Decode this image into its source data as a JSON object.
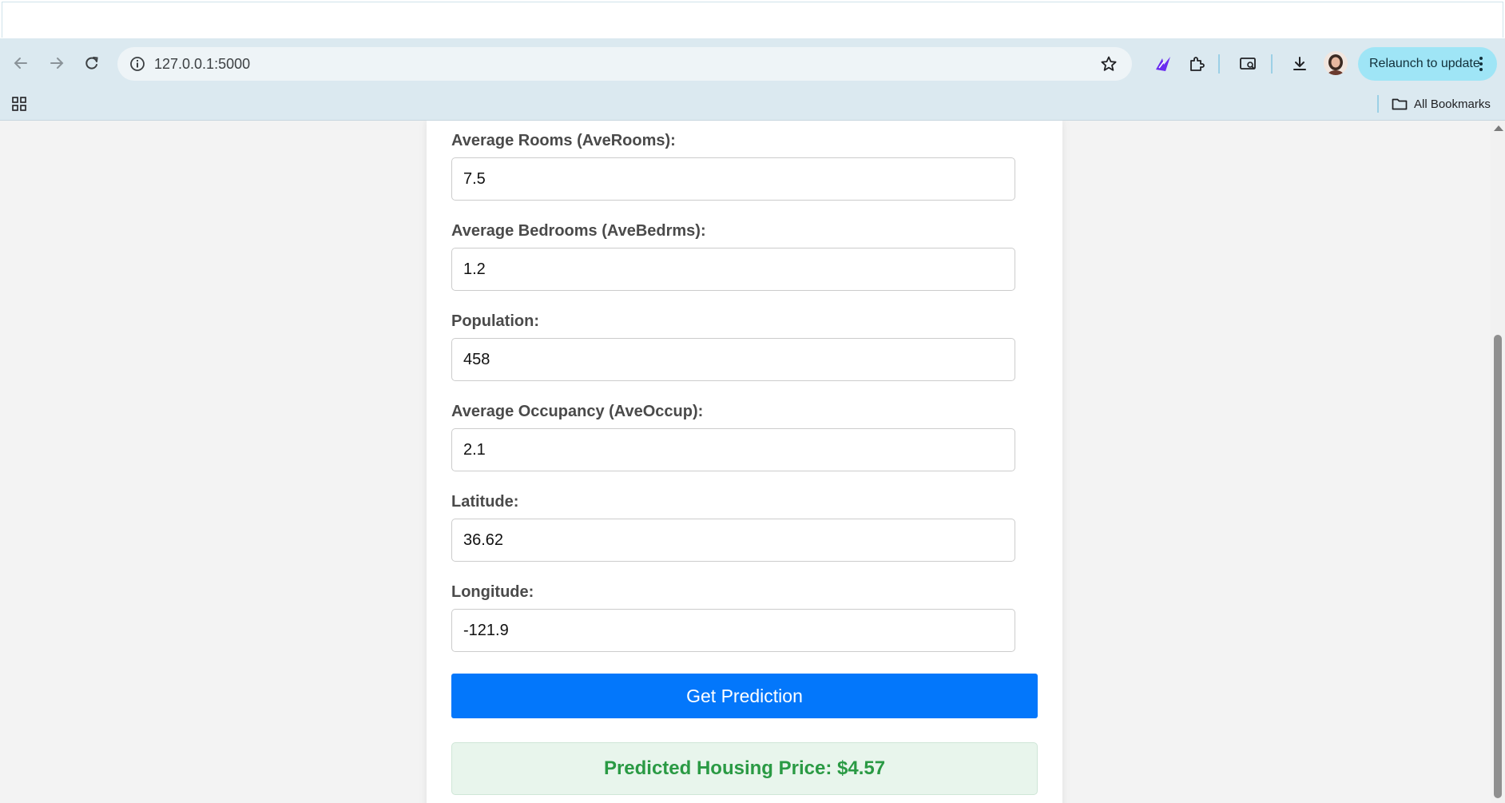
{
  "browser": {
    "url": "127.0.0.1:5000",
    "relaunch_label": "Relaunch to update",
    "all_bookmarks_label": "All Bookmarks",
    "icons": [
      "back-icon",
      "forward-icon",
      "reload-icon",
      "site-info-icon",
      "bookmark-star-icon",
      "extension-icon",
      "puzzle-icon",
      "screen-search-icon",
      "download-icon",
      "profile-avatar",
      "more-vert-icon",
      "apps-grid-icon",
      "folder-icon"
    ]
  },
  "form": {
    "fields": [
      {
        "label": "Average Rooms (AveRooms):",
        "value": "7.5"
      },
      {
        "label": "Average Bedrooms (AveBedrms):",
        "value": "1.2"
      },
      {
        "label": "Population:",
        "value": "458"
      },
      {
        "label": "Average Occupancy (AveOccup):",
        "value": "2.1"
      },
      {
        "label": "Latitude:",
        "value": "36.62"
      },
      {
        "label": "Longitude:",
        "value": "-121.9"
      }
    ],
    "submit_label": "Get Prediction"
  },
  "result": {
    "text": "Predicted Housing Price: $4.57"
  },
  "colors": {
    "accent_button": "#0377fb",
    "result_text": "#2a9a44",
    "result_bg": "#e8f5ec"
  }
}
